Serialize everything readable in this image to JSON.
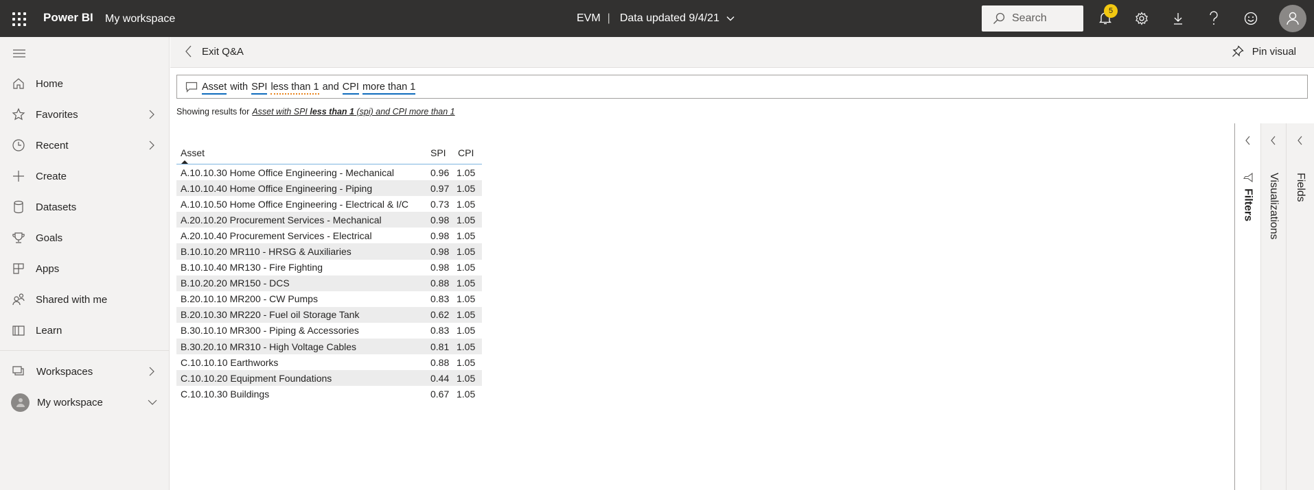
{
  "topbar": {
    "app_name": "Power BI",
    "workspace": "My workspace",
    "report_name": "EVM",
    "separator": "|",
    "data_updated": "Data updated 9/4/21",
    "search_placeholder": "Search",
    "notification_count": "5",
    "icons": [
      "app-launcher-icon",
      "notifications-icon",
      "settings-icon",
      "download-icon",
      "help-icon",
      "feedback-smiley-icon",
      "account-avatar-icon"
    ]
  },
  "sidebar": {
    "items": [
      {
        "label": "Home",
        "icon": "home-icon"
      },
      {
        "label": "Favorites",
        "icon": "star-icon",
        "has_arrow": true
      },
      {
        "label": "Recent",
        "icon": "clock-icon",
        "has_arrow": true
      },
      {
        "label": "Create",
        "icon": "plus-icon"
      },
      {
        "label": "Datasets",
        "icon": "database-icon"
      },
      {
        "label": "Goals",
        "icon": "trophy-icon"
      },
      {
        "label": "Apps",
        "icon": "apps-icon"
      },
      {
        "label": "Shared with me",
        "icon": "shared-icon"
      },
      {
        "label": "Learn",
        "icon": "book-icon"
      }
    ],
    "workspaces_label": "Workspaces",
    "my_workspace_label": "My workspace"
  },
  "qa": {
    "exit_label": "Exit Q&A",
    "pin_label": "Pin visual",
    "question_tokens": [
      {
        "text": "Asset",
        "underline": "blue"
      },
      {
        "text": "with",
        "underline": "none"
      },
      {
        "text": "SPI",
        "underline": "blue"
      },
      {
        "text": "less than 1",
        "underline": "orange-dotted"
      },
      {
        "text": "and",
        "underline": "none"
      },
      {
        "text": "CPI",
        "underline": "blue"
      },
      {
        "text": "more than 1",
        "underline": "blue"
      }
    ],
    "showing_prefix": "Showing results for",
    "restatement_pre": "Asset with SPI ",
    "restatement_bold": "less than 1",
    "restatement_post": " (spi) and CPI more than 1"
  },
  "table": {
    "columns": [
      "Asset",
      "SPI",
      "CPI"
    ],
    "sort_column": "Asset",
    "sort_direction": "ascending",
    "rows": [
      {
        "asset": "A.10.10.30 Home Office Engineering - Mechanical",
        "spi": "0.96",
        "cpi": "1.05"
      },
      {
        "asset": "A.10.10.40 Home Office Engineering - Piping",
        "spi": "0.97",
        "cpi": "1.05"
      },
      {
        "asset": "A.10.10.50 Home Office Engineering - Electrical & I/C",
        "spi": "0.73",
        "cpi": "1.05"
      },
      {
        "asset": "A.20.10.20 Procurement Services - Mechanical",
        "spi": "0.98",
        "cpi": "1.05"
      },
      {
        "asset": "A.20.10.40 Procurement Services - Electrical",
        "spi": "0.98",
        "cpi": "1.05"
      },
      {
        "asset": "B.10.10.20 MR110 - HRSG & Auxiliaries",
        "spi": "0.98",
        "cpi": "1.05"
      },
      {
        "asset": "B.10.10.40 MR130 - Fire Fighting",
        "spi": "0.98",
        "cpi": "1.05"
      },
      {
        "asset": "B.10.20.20 MR150 - DCS",
        "spi": "0.88",
        "cpi": "1.05"
      },
      {
        "asset": "B.20.10.10 MR200 - CW Pumps",
        "spi": "0.83",
        "cpi": "1.05"
      },
      {
        "asset": "B.20.10.30 MR220 - Fuel oil Storage Tank",
        "spi": "0.62",
        "cpi": "1.05"
      },
      {
        "asset": "B.30.10.10 MR300 - Piping & Accessories",
        "spi": "0.83",
        "cpi": "1.05"
      },
      {
        "asset": "B.30.20.10 MR310 - High Voltage Cables",
        "spi": "0.81",
        "cpi": "1.05"
      },
      {
        "asset": "C.10.10.10 Earthworks",
        "spi": "0.88",
        "cpi": "1.05"
      },
      {
        "asset": "C.10.10.20 Equipment Foundations",
        "spi": "0.44",
        "cpi": "1.05"
      },
      {
        "asset": "C.10.10.30 Buildings",
        "spi": "0.67",
        "cpi": "1.05"
      }
    ]
  },
  "panes": {
    "filters": "Filters",
    "visualizations": "Visualizations",
    "fields": "Fields"
  },
  "colors": {
    "topbar_bg": "#323130",
    "badge": "#f2c811",
    "token_underline": "#0f6cbd",
    "warning_underline": "#e8831c"
  }
}
